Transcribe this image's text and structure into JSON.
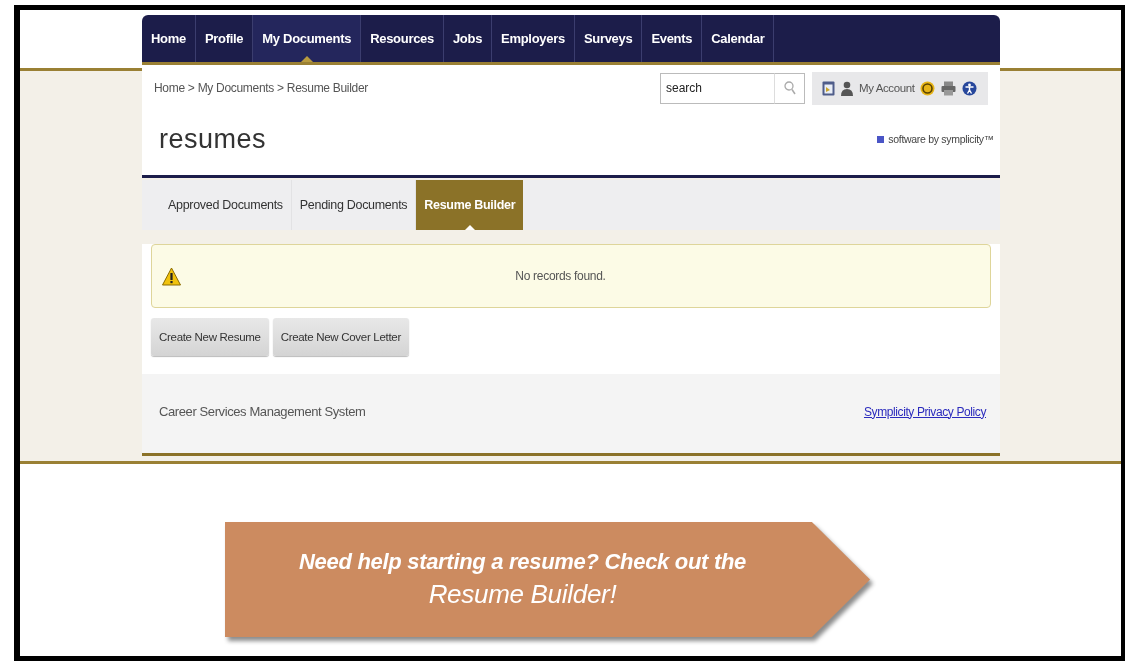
{
  "nav": {
    "items": [
      {
        "label": "Home",
        "selected": false
      },
      {
        "label": "Profile",
        "selected": false
      },
      {
        "label": "My Documents",
        "selected": true
      },
      {
        "label": "Resources",
        "selected": false
      },
      {
        "label": "Jobs",
        "selected": false
      },
      {
        "label": "Employers",
        "selected": false
      },
      {
        "label": "Surveys",
        "selected": false
      },
      {
        "label": "Events",
        "selected": false
      },
      {
        "label": "Calendar",
        "selected": false
      }
    ]
  },
  "breadcrumb": {
    "separator": ">",
    "items": [
      "Home",
      "My Documents",
      "Resume Builder"
    ]
  },
  "search": {
    "placeholder": "search"
  },
  "account": {
    "label": "My Account"
  },
  "page_title": "resumes",
  "brand": "software by symplicity™",
  "tabs": [
    {
      "label": "Approved Documents",
      "selected": false
    },
    {
      "label": "Pending Documents",
      "selected": false
    },
    {
      "label": "Resume Builder",
      "selected": true
    }
  ],
  "alert": {
    "message": "No records found."
  },
  "buttons": [
    "Create New Resume",
    "Create New Cover Letter"
  ],
  "footer": {
    "text": "Career Services Management System",
    "link": "Symplicity Privacy Policy"
  },
  "callout": {
    "line_1": "Need help starting a resume? Check out the",
    "line_2": "Resume Builder!"
  }
}
